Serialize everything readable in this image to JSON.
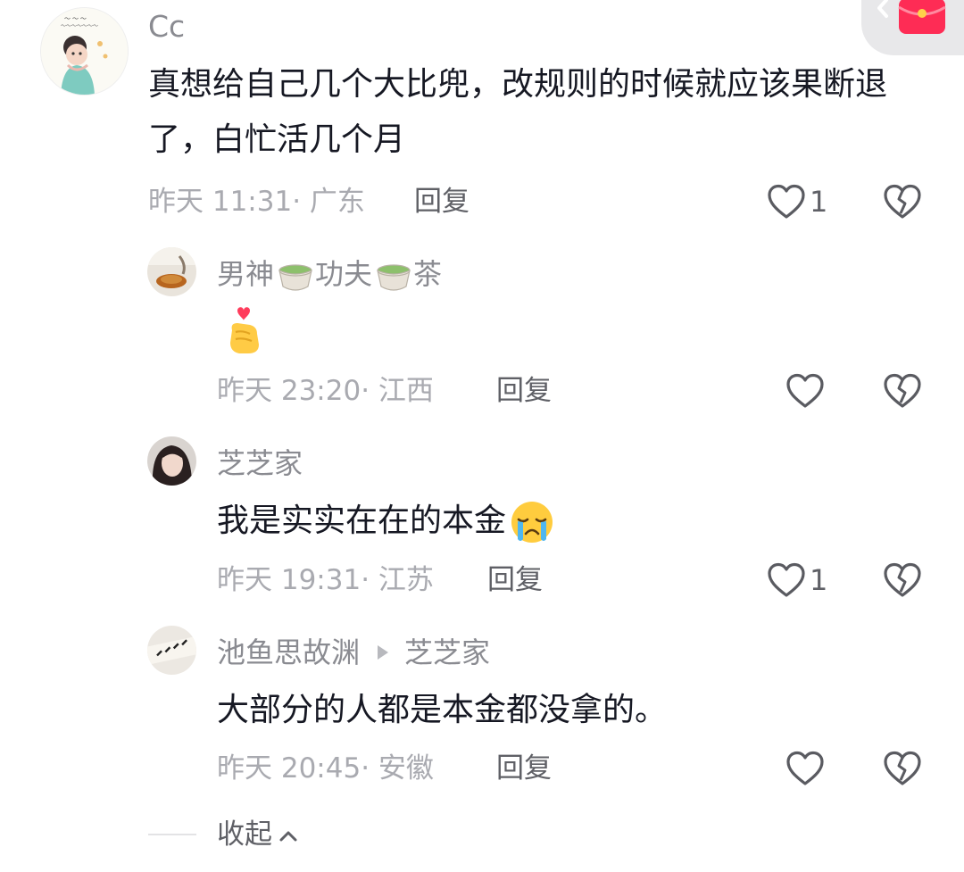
{
  "float_button": {
    "arrow_icon": "chevron-left-icon",
    "badge_icon": "red-envelope-icon"
  },
  "comments": [
    {
      "user": "Cc",
      "text": "真想给自己几个大比兜，改规则的时候就应该果断退了，白忙活几个月",
      "time": "昨天 11:31",
      "location": "广东",
      "reply_label": "回复",
      "likes": "1"
    },
    {
      "user_parts": [
        "男神",
        "功夫",
        "茶"
      ],
      "text_emoji": "heart-hands-emoji",
      "time": "昨天 23:20",
      "location": "江西",
      "reply_label": "回复",
      "likes": ""
    },
    {
      "user": "芝芝家",
      "text": "我是实实在在的本金",
      "time": "昨天 19:31",
      "location": "江苏",
      "reply_label": "回复",
      "likes": "1"
    },
    {
      "user": "池鱼思故渊",
      "reply_to": "芝芝家",
      "text": "大部分的人都是本金都没拿的。",
      "time": "昨天 20:45",
      "location": "安徽",
      "reply_label": "回复",
      "likes": ""
    }
  ],
  "collapse_label": "收起",
  "colors": {
    "text": "#161823",
    "secondary": "#8a8b91",
    "meta": "#a9aab0",
    "accent_red": "#fe2c55"
  }
}
